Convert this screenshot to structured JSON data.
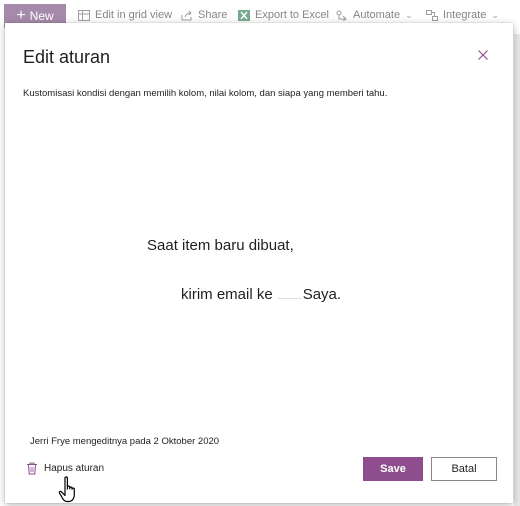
{
  "toolbar": {
    "new_label": "New",
    "edit_grid_label": "Edit in grid view",
    "share_label": "Share",
    "export_label": "Export to Excel",
    "automate_label": "Automate",
    "integrate_label": "Integrate"
  },
  "dialog": {
    "title": "Edit aturan",
    "description": "Kustomisasi kondisi dengan memilih kolom, nilai kolom, dan siapa yang memberi tahu.",
    "rule_line1": "Saat item baru dibuat,",
    "rule_line2_prefix": "kirim email ke",
    "rule_line2_target": "Saya.",
    "modified_info": "Jerri Frye mengeditnya pada 2 Oktober 2020",
    "delete_label": "Hapus aturan",
    "save_label": "Save",
    "cancel_label": "Batal"
  },
  "colors": {
    "accent": "#8e4e8e",
    "new_button": "#6b3d73",
    "close_icon": "#8e4e8e"
  },
  "icons": {
    "new": "plus-icon",
    "grid": "grid-icon",
    "share": "share-icon",
    "excel": "excel-icon",
    "automate": "flow-icon",
    "integrate": "integrate-icon",
    "close": "close-icon",
    "delete": "trash-icon",
    "pointer": "hand-pointer-icon"
  }
}
